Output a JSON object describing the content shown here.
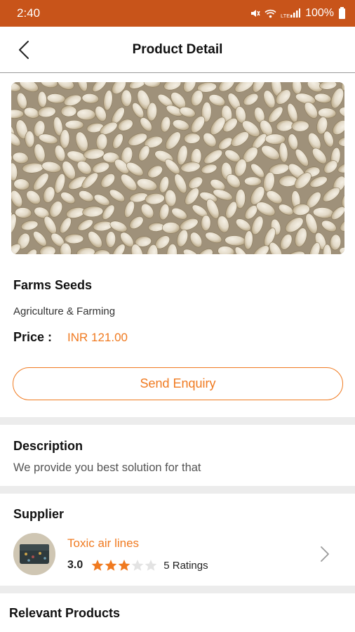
{
  "status_bar": {
    "time": "2:40",
    "battery": "100%",
    "icons": [
      "mute-icon",
      "wifi-icon",
      "lte-signal-icon",
      "battery-icon"
    ],
    "background": "#c8541a"
  },
  "header": {
    "title": "Product Detail",
    "back_icon": "chevron-left-icon"
  },
  "product": {
    "name": "Farms Seeds",
    "category": "Agriculture & Farming",
    "price_label": "Price :",
    "price_value": "INR 121.00",
    "enquiry_label": "Send Enquiry"
  },
  "description": {
    "title": "Description",
    "text": "We provide you best solution for that"
  },
  "supplier": {
    "title": "Supplier",
    "name": "Toxic air lines",
    "rating": "3.0",
    "stars_filled": 3,
    "stars_total": 5,
    "ratings_count": "5 Ratings"
  },
  "relevant": {
    "title": "Relevant Products"
  },
  "colors": {
    "accent": "#f07a20",
    "status_bar": "#c8541a",
    "star_filled": "#f07a20",
    "star_empty": "#e3e3e3"
  }
}
